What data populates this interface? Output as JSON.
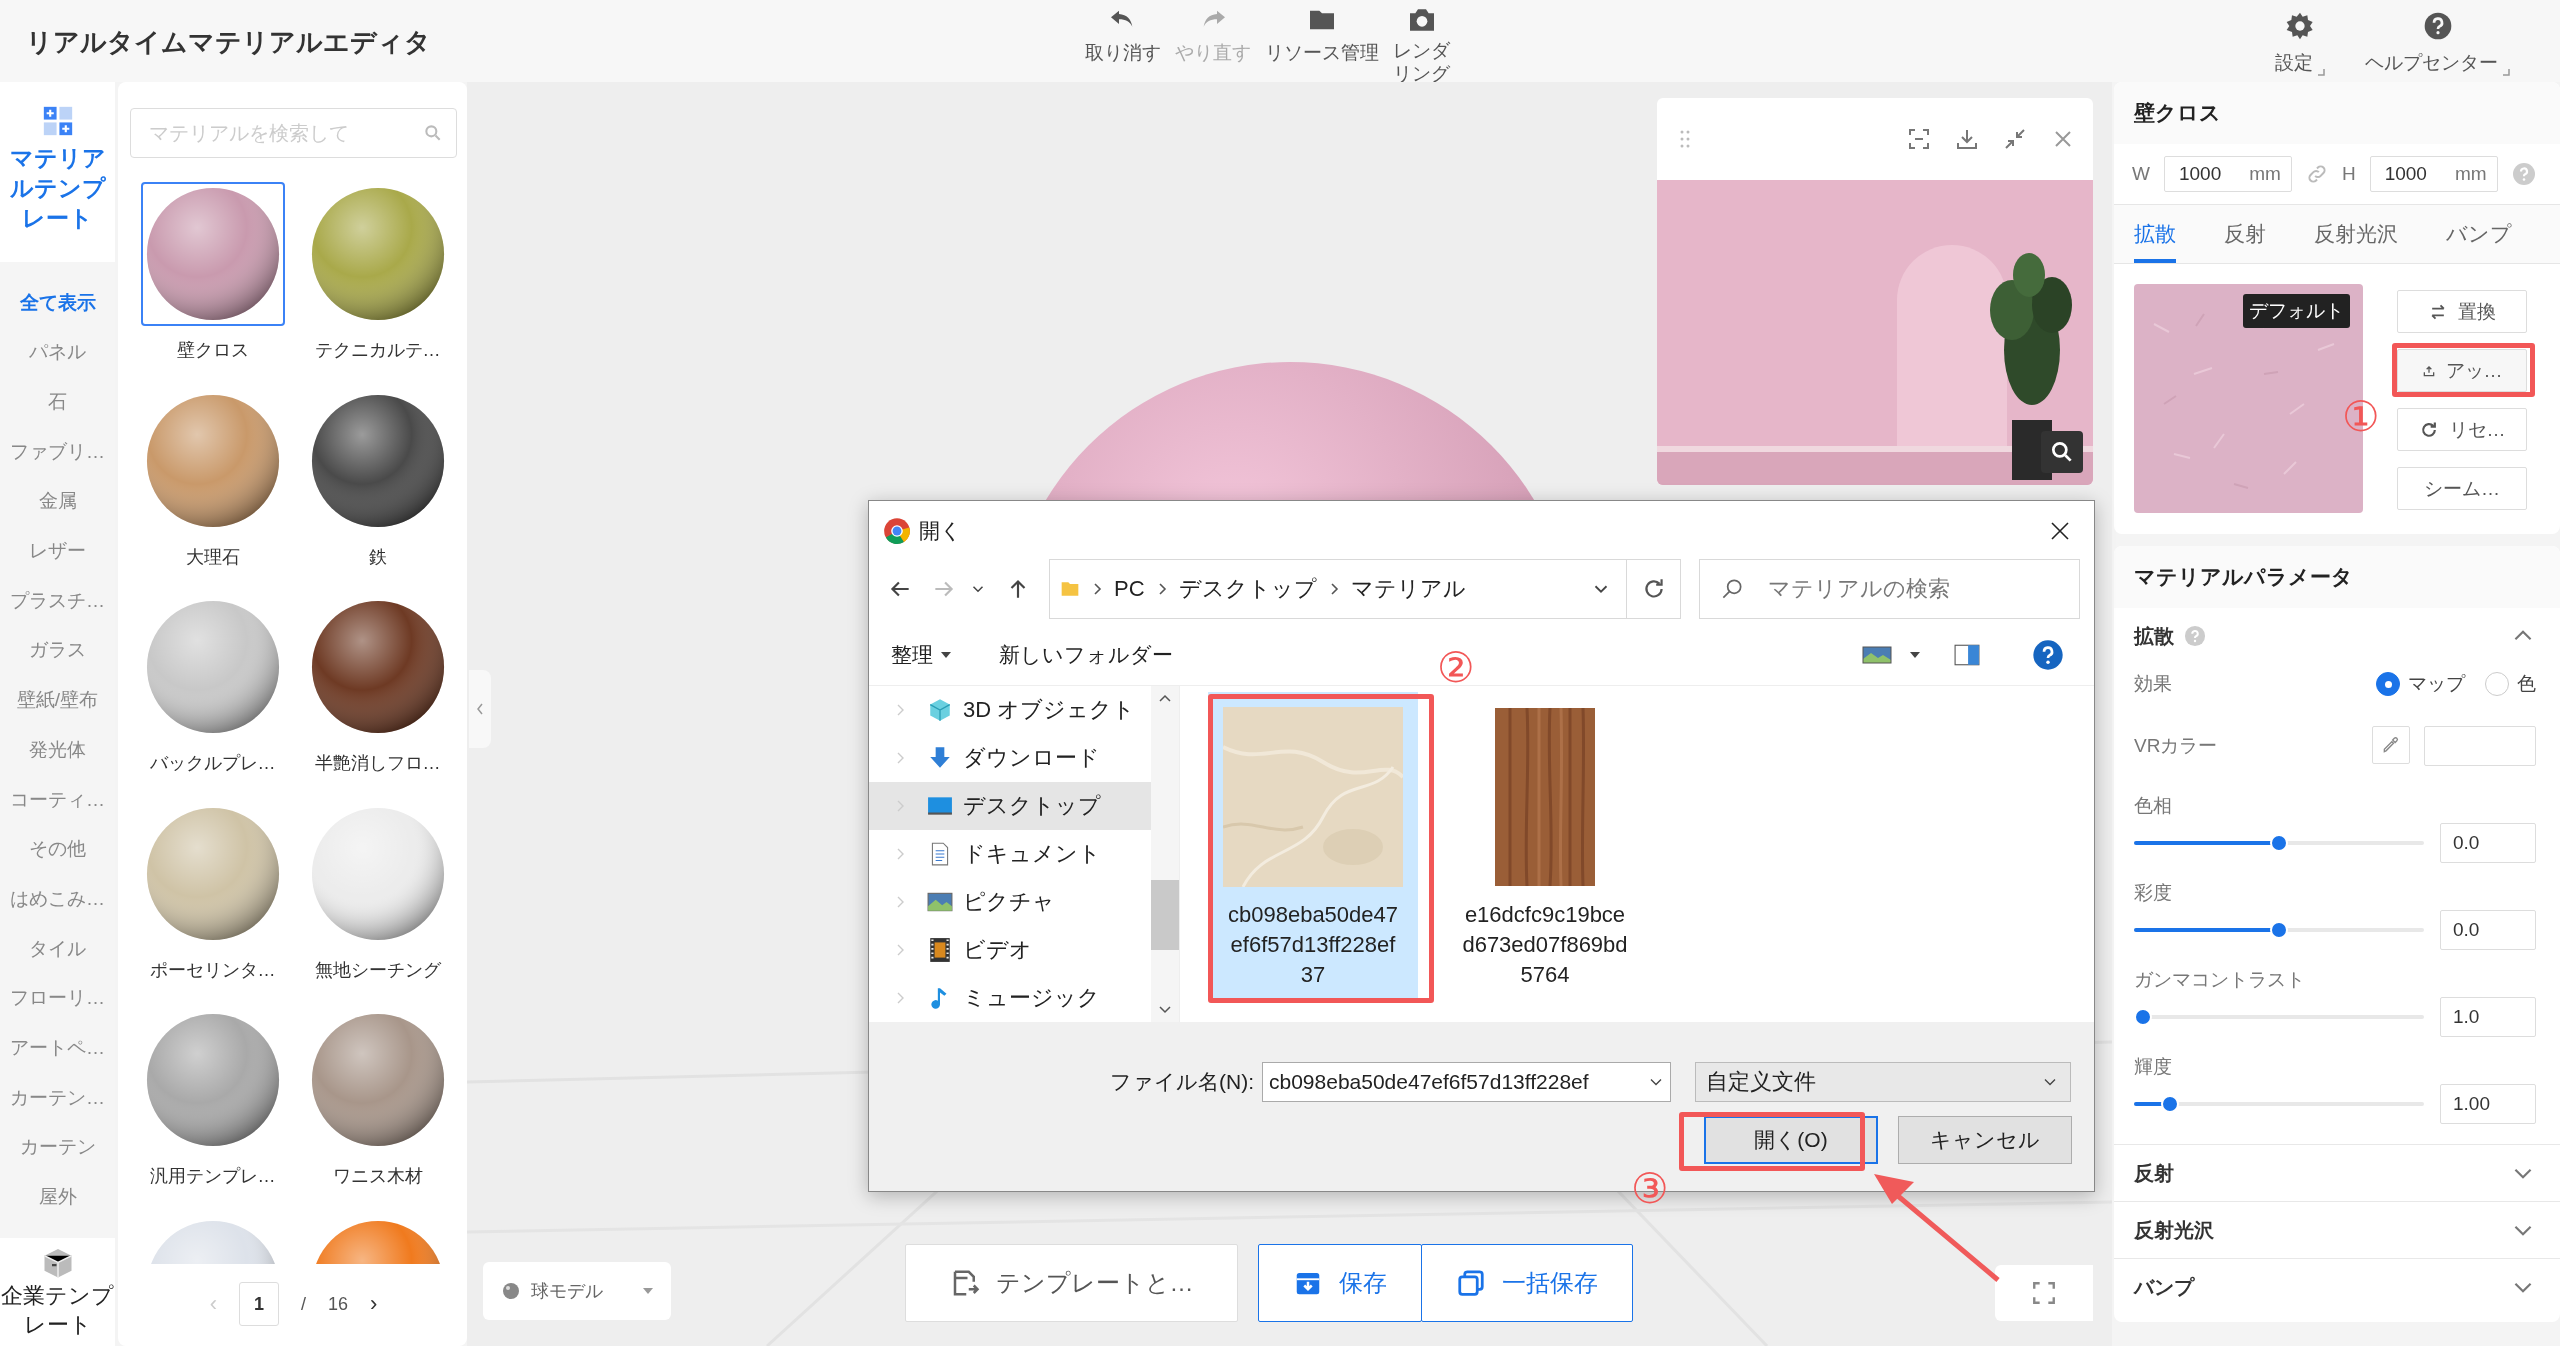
{
  "app": {
    "title": "リアルタイムマテリアルエディタ"
  },
  "toolbar": [
    {
      "label": "取り消す",
      "kind": "undo",
      "disabled": false
    },
    {
      "label": "やり直す",
      "kind": "redo",
      "disabled": true
    },
    {
      "label": "リソース管理",
      "kind": "folder",
      "disabled": false
    },
    {
      "label": "レンダリング",
      "kind": "camera",
      "disabled": false
    }
  ],
  "header_links": [
    {
      "label": "設定",
      "kind": "gear"
    },
    {
      "label": "ヘルプセンター",
      "kind": "help"
    }
  ],
  "nav": {
    "top": {
      "label": "マテリアルテンプレート",
      "selected": true
    },
    "categories": [
      {
        "label": "全て表示",
        "selected": true
      },
      {
        "label": "パネル",
        "selected": false
      },
      {
        "label": "石",
        "selected": false
      },
      {
        "label": "ファブリ…",
        "selected": false
      },
      {
        "label": "金属",
        "selected": false
      },
      {
        "label": "レザー",
        "selected": false
      },
      {
        "label": "プラスチ…",
        "selected": false
      },
      {
        "label": "ガラス",
        "selected": false
      },
      {
        "label": "壁紙/壁布",
        "selected": false
      },
      {
        "label": "発光体",
        "selected": false
      },
      {
        "label": "コーティ…",
        "selected": false
      },
      {
        "label": "その他",
        "selected": false
      },
      {
        "label": "はめこみ…",
        "selected": false
      },
      {
        "label": "タイル",
        "selected": false
      },
      {
        "label": "フローリ…",
        "selected": false
      },
      {
        "label": "アートペ…",
        "selected": false
      },
      {
        "label": "カーテン…",
        "selected": false
      },
      {
        "label": "カーテン",
        "selected": false
      },
      {
        "label": "屋外",
        "selected": false
      }
    ],
    "bottom": {
      "label": "企業テンプレート",
      "selected": false
    }
  },
  "materials": {
    "search": {
      "placeholder": "マテリアルを検索して"
    },
    "items": [
      {
        "label": "壁クロス",
        "color": "#c99aae",
        "selected": true
      },
      {
        "label": "テクニカルテ…",
        "color": "#a9a94a",
        "selected": false
      },
      {
        "label": "大理石",
        "color": "#c9996a",
        "selected": false
      },
      {
        "label": "鉄",
        "color": "#4a4a4a",
        "selected": false
      },
      {
        "label": "バックルプレ…",
        "color": "#c8c8c8",
        "selected": false
      },
      {
        "label": "半艶消しフロ…",
        "color": "#6e3a24",
        "selected": false
      },
      {
        "label": "ポーセリンタ…",
        "color": "#cfc3a6",
        "selected": false
      },
      {
        "label": "無地シーチング",
        "color": "#ececec",
        "selected": false
      },
      {
        "label": "汎用テンプレ…",
        "color": "#a9a9a9",
        "selected": false
      },
      {
        "label": "ワニス木材",
        "color": "#a8968a",
        "selected": false
      },
      {
        "color": "#dde2ea",
        "selected": false
      },
      {
        "color": "#f07a1e",
        "selected": false
      }
    ],
    "pagination": {
      "prev": "‹",
      "page": "1",
      "separator": "/",
      "total": "16",
      "next": "›"
    }
  },
  "canvas": {
    "model_select": {
      "value": "球モデル"
    },
    "buttons": [
      {
        "label": "テンプレートと…",
        "kind": "template"
      },
      {
        "label": "保存",
        "kind": "save"
      },
      {
        "label": "一括保存",
        "kind": "save_all"
      }
    ]
  },
  "properties": {
    "title": "壁クロス",
    "width": {
      "label": "W",
      "value": "1000",
      "unit": "mm"
    },
    "height": {
      "label": "H",
      "value": "1000",
      "unit": "mm"
    },
    "tabs": [
      {
        "label": "拡散",
        "selected": true
      },
      {
        "label": "反射",
        "selected": false
      },
      {
        "label": "反射光沢",
        "selected": false
      },
      {
        "label": "バンプ",
        "selected": false
      }
    ],
    "texture_badge": "デフォルト",
    "actions": [
      {
        "label": "置換",
        "kind": "swap"
      },
      {
        "label": "アッ…",
        "kind": "upload"
      },
      {
        "label": "リセ…",
        "kind": "reset"
      },
      {
        "label": "シーム…",
        "kind": "plain"
      }
    ]
  },
  "parameters": {
    "title": "マテリアルパラメータ",
    "sections": [
      {
        "title": "拡散",
        "expanded": true
      },
      {
        "title": "反射",
        "expanded": false
      },
      {
        "title": "反射光沢",
        "expanded": false
      },
      {
        "title": "バンプ",
        "expanded": false
      }
    ],
    "effect": {
      "label": "効果",
      "options": [
        {
          "label": "マップ",
          "selected": true
        },
        {
          "label": "色",
          "selected": false
        }
      ]
    },
    "vr_color": {
      "label": "VRカラー"
    },
    "sliders": [
      {
        "label": "色相",
        "level": 0.5,
        "value": "0.0"
      },
      {
        "label": "彩度",
        "level": 0.5,
        "value": "0.0"
      },
      {
        "label": "ガンマコントラスト",
        "level": 0.0,
        "value": "1.0"
      },
      {
        "label": "輝度",
        "level": 0.1,
        "value": "1.00"
      }
    ]
  },
  "dialog": {
    "title": "開く",
    "path": [
      "PC",
      "デスクトップ",
      "マテリアル"
    ],
    "search": {
      "placeholder": "マテリアルの検索"
    },
    "organize": "整理",
    "new_folder": "新しいフォルダー",
    "tree": [
      {
        "label": "3D オブジェクト",
        "kind": "cube",
        "selected": false
      },
      {
        "label": "ダウンロード",
        "kind": "download",
        "selected": false
      },
      {
        "label": "デスクトップ",
        "kind": "desktop",
        "selected": true
      },
      {
        "label": "ドキュメント",
        "kind": "document",
        "selected": false
      },
      {
        "label": "ピクチャ",
        "kind": "pictures",
        "selected": false
      },
      {
        "label": "ビデオ",
        "kind": "video",
        "selected": false
      },
      {
        "label": "ミュージック",
        "kind": "music",
        "selected": false
      }
    ],
    "files": [
      {
        "name": "cb098eba50de47ef6f57d13ff228ef37",
        "selected": true
      },
      {
        "name": "e16dcfc9c19bced673ed07f869bd5764",
        "selected": false
      }
    ],
    "filename": {
      "label": "ファイル名(N):",
      "value": "cb098eba50de47ef6f57d13ff228ef"
    },
    "filetype": "自定义文件",
    "buttons": [
      {
        "label": "開く(O)",
        "kind": "primary"
      },
      {
        "label": "キャンセル",
        "kind": "cancel"
      }
    ]
  },
  "annotations": [
    {
      "text": "①"
    },
    {
      "text": "②"
    },
    {
      "text": "③"
    }
  ]
}
